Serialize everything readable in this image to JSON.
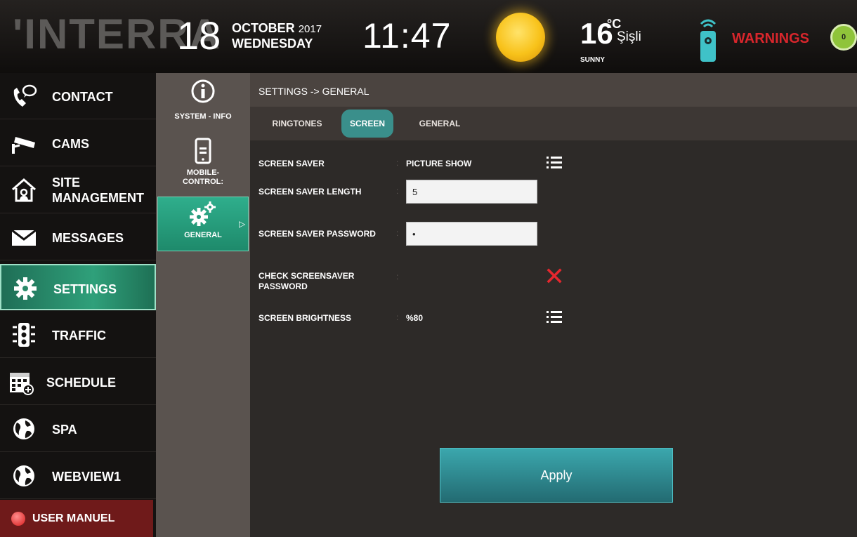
{
  "header": {
    "logo": "'INTERRA",
    "day": "18",
    "month": "OCTOBER",
    "year": "2017",
    "weekday": "WEDNESDAY",
    "time": "11:47",
    "weather_icon": "sun-icon",
    "temperature": "16",
    "temp_unit": "°C",
    "city": "Şişli",
    "condition": "SUNNY",
    "remote_icon": "remote-icon",
    "warnings_label": "WARNINGS",
    "warnings_count": "0",
    "warnings_color": "#d8262c",
    "badge_color": "#8fc43a"
  },
  "menu": {
    "items": [
      {
        "label": "CONTACT",
        "icon": "phone-chat-icon"
      },
      {
        "label": "CAMS",
        "icon": "camera-icon"
      },
      {
        "label": "SITE MANAGEMENT",
        "line1": "SITE",
        "line2": "MANAGEMENT",
        "icon": "house-icon"
      },
      {
        "label": "MESSAGES",
        "icon": "envelope-icon"
      },
      {
        "label": "SETTINGS",
        "icon": "gear-icon",
        "active": true
      },
      {
        "label": "TRAFFIC",
        "icon": "traffic-light-icon"
      },
      {
        "label": "SCHEDULE",
        "icon": "calendar-icon"
      },
      {
        "label": "SPA",
        "icon": "globe-icon"
      },
      {
        "label": "WEBVIEW1",
        "icon": "globe-icon"
      }
    ],
    "user_manual": "USER MANUEL",
    "active_color": "#2fa07a"
  },
  "submenu": {
    "items": [
      {
        "label": "SYSTEM - INFO",
        "icon": "info-icon"
      },
      {
        "label_line1": "MOBILE-",
        "label_line2": "CONTROL:",
        "icon": "mobile-icon"
      },
      {
        "label": "GENERAL",
        "icon": "gears-icon",
        "active": true
      }
    ]
  },
  "content": {
    "breadcrumb": "SETTINGS -> GENERAL",
    "tabs": [
      {
        "label": "RINGTONES"
      },
      {
        "label": "SCREEN",
        "active": true
      },
      {
        "label": "GENERAL"
      }
    ],
    "tab_active_color": "#3a8f8b",
    "fields": {
      "screen_saver": {
        "label": "SCREEN SAVER",
        "value": "PICTURE SHOW"
      },
      "screen_saver_length": {
        "label": "SCREEN SAVER LENGTH",
        "value": "5"
      },
      "screen_saver_password": {
        "label": "SCREEN SAVER PASSWORD",
        "value": "•"
      },
      "check_password": {
        "label_line1": "CHECK SCREENSAVER",
        "label_line2": "PASSWORD",
        "checked": false
      },
      "screen_brightness": {
        "label": "SCREEN BRIGHTNESS",
        "value": "%80"
      }
    },
    "apply_label": "Apply",
    "cross_color": "#e5272e"
  }
}
